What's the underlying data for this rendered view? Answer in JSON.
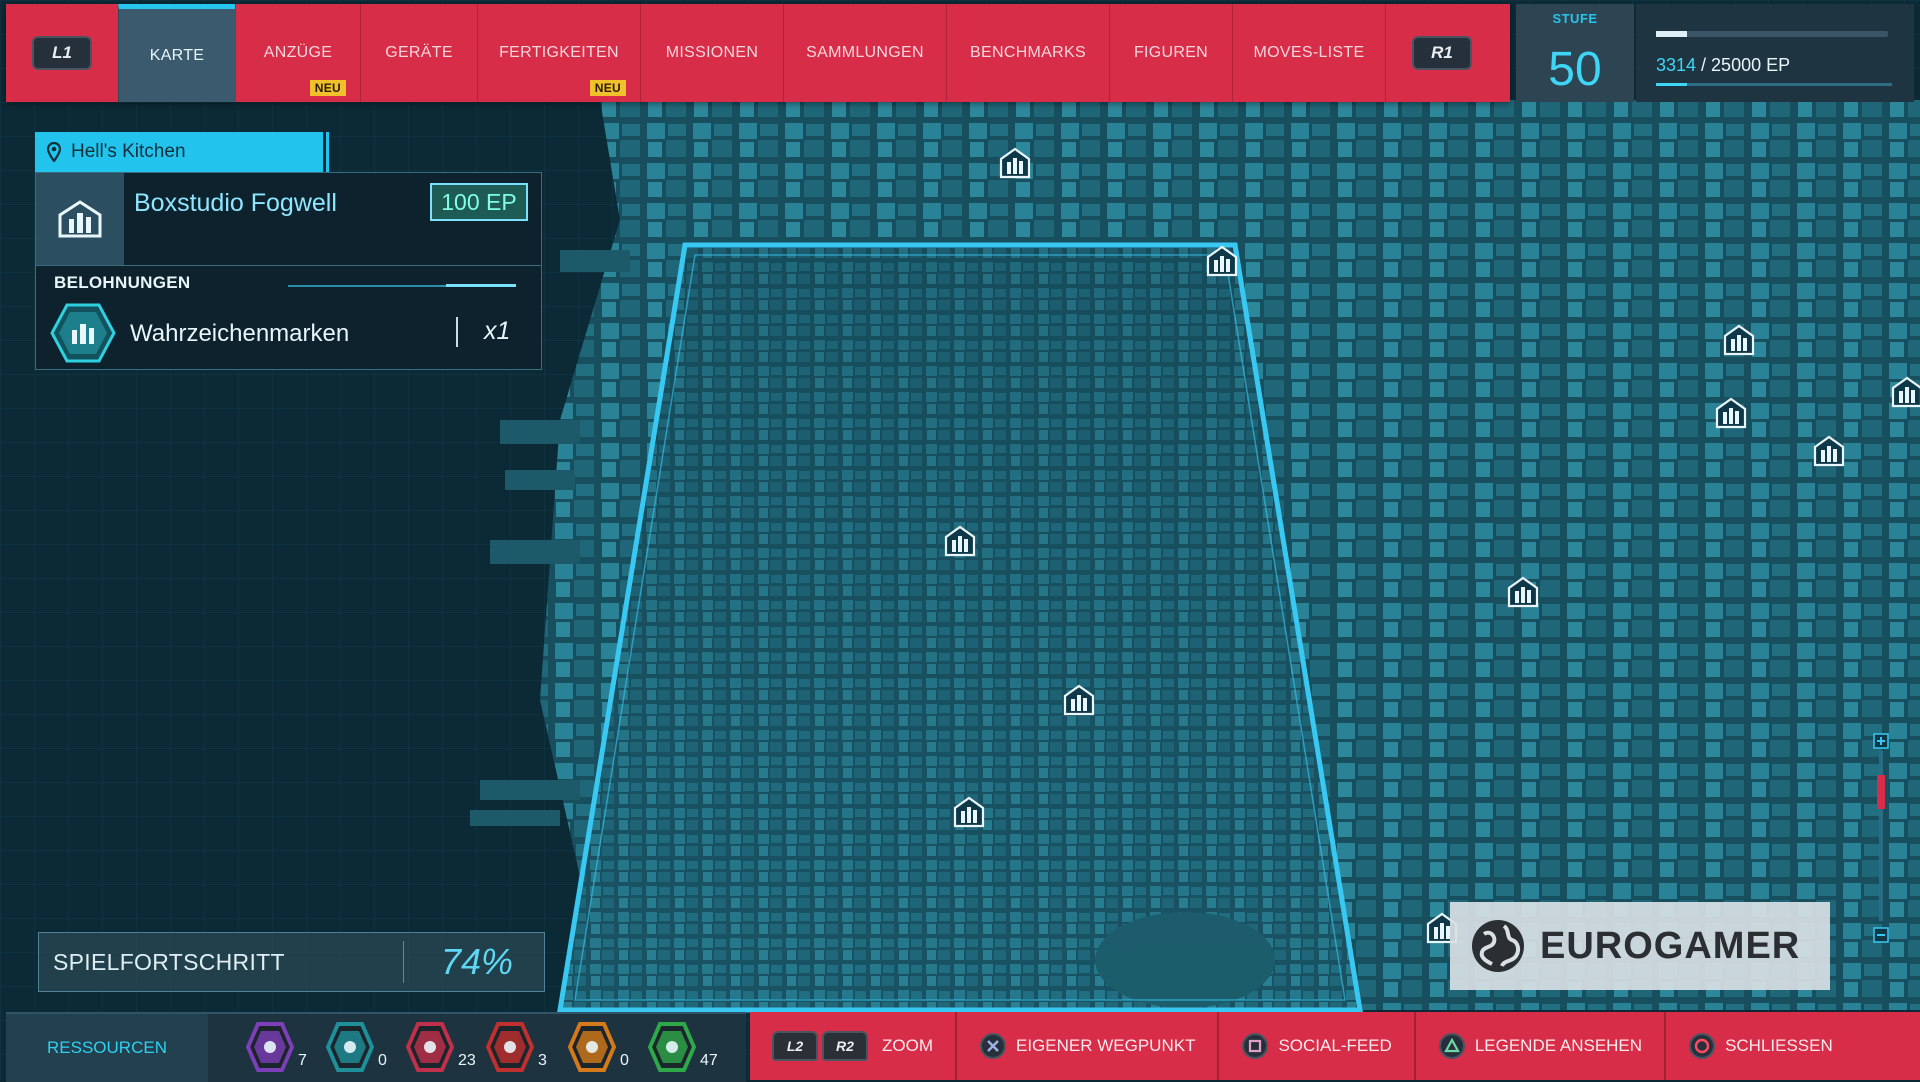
{
  "topbar": {
    "left_shoulder": "L1",
    "right_shoulder": "R1",
    "tabs": [
      {
        "label": "KARTE",
        "badge": ""
      },
      {
        "label": "ANZÜGE",
        "badge": "NEU"
      },
      {
        "label": "GERÄTE",
        "badge": ""
      },
      {
        "label": "FERTIGKEITEN",
        "badge": "NEU"
      },
      {
        "label": "MISSIONEN",
        "badge": ""
      },
      {
        "label": "SAMMLUNGEN",
        "badge": ""
      },
      {
        "label": "BENCHMARKS",
        "badge": ""
      },
      {
        "label": "FIGUREN",
        "badge": ""
      },
      {
        "label": "MOVES-LISTE",
        "badge": ""
      }
    ],
    "active_tab": "KARTE"
  },
  "level": {
    "label": "STUFE",
    "value": "50"
  },
  "xp": {
    "current": "3314",
    "rest": " / 25000 EP",
    "progress": 0.1326
  },
  "location": {
    "district": "Hell's Kitchen"
  },
  "landmark": {
    "title": "Boxstudio Fogwell",
    "ep": "100 EP",
    "rewards_title": "BELOHNUNGEN",
    "reward_name": "Wahrzeichenmarken",
    "reward_count": "x1",
    "icon": "landmark-icon"
  },
  "progress": {
    "label": "SPIELFORTSCHRITT",
    "value": "74%",
    "fraction": 0.74
  },
  "resources": {
    "label": "RESSOURCEN",
    "items": [
      {
        "icon": "research-token-icon",
        "color": "#7c3fb8",
        "count": "7"
      },
      {
        "icon": "landmark-token-icon",
        "color": "#1f8f9a",
        "count": "0"
      },
      {
        "icon": "backpack-token-icon",
        "color": "#c0304a",
        "count": "23"
      },
      {
        "icon": "crime-token-icon",
        "color": "#c0302f",
        "count": "3"
      },
      {
        "icon": "challenge-token-icon",
        "color": "#d47a1a",
        "count": "0"
      },
      {
        "icon": "base-token-icon",
        "color": "#2fa84a",
        "count": "47"
      }
    ]
  },
  "controls": {
    "l2": "L2",
    "r2": "R2",
    "zoom": "ZOOM",
    "waypoint": "EIGENER WEGPUNKT",
    "social": "SOCIAL-FEED",
    "legend": "LEGENDE ANSEHEN",
    "close": "SCHLIESSEN"
  },
  "watermark": {
    "text": "EUROGAMER"
  },
  "colors": {
    "accent": "#d72d48",
    "cyan": "#22c3ec",
    "map": "#0b2733"
  }
}
